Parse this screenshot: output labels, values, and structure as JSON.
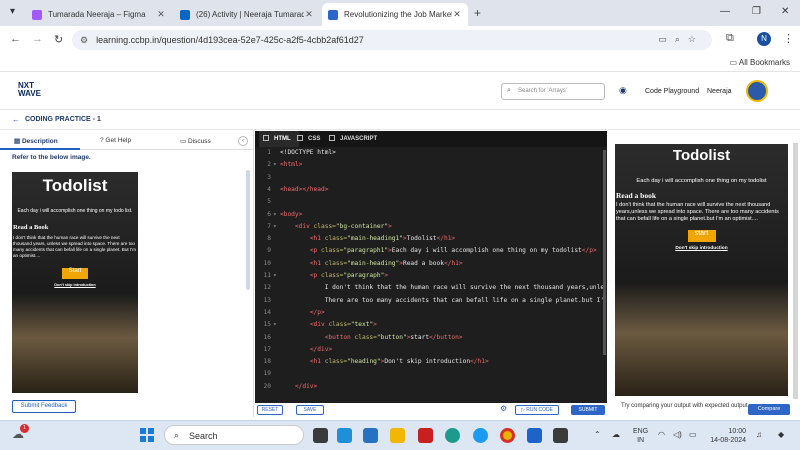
{
  "browser": {
    "tabs": [
      {
        "title": "Tumarada Neeraja – Figma",
        "color": "#a259ff"
      },
      {
        "title": "(26) Activity | Neeraja Tumarad",
        "color": "#0a66c2"
      },
      {
        "title": "Revolutionizing the Job Market",
        "color": "#2d66c7"
      }
    ],
    "new_tab": "+",
    "url": "learning.ccbp.in/question/4d193cea-52e7-425c-a2f5-4cbb2af61d27",
    "profile_initial": "N",
    "bookmarks_label": "All Bookmarks"
  },
  "header": {
    "logo_line1": "NXT",
    "logo_line2": "WAVE",
    "search_placeholder": "Search for 'Arrays'",
    "code_playground": "Code Playground",
    "user_name": "Neeraja"
  },
  "breadcrumb": {
    "label": "CODING PRACTICE - 1"
  },
  "left_tabs": {
    "description": "Description",
    "get_help": "Get Help",
    "discuss": "Discuss"
  },
  "left": {
    "refer": "Refer to the below image.",
    "submit_feedback": "Submit Feedback"
  },
  "preview": {
    "title": "Todolist",
    "subtitle": "Each day i will accomplish one thing on my todo list.",
    "subtitle_right": "Each day i will accomplish one thing on my todolist",
    "heading": "Read a Book",
    "heading_right": "Read a book",
    "paragraph_left": "I don't think that the human race will survive the next thousand years, unless we spread into space. There are too many accidents that can befall life on a single planet. But I'm an optimist....",
    "paragraph_right": "I don't think that the human race will survive the next thousand years,unless we spread into space. There are too many accidents that can befall life on a single planet.but I'm an optimist....",
    "button": "Start",
    "button_right": "start",
    "link": "Don't skip introduction"
  },
  "editor": {
    "tabs": [
      "HTML",
      "CSS",
      "JAVASCRIPT"
    ],
    "lines": [
      {
        "n": "1",
        "f": "",
        "html": "&lt;!DOCTYPE html&gt;"
      },
      {
        "n": "2",
        "f": "▾",
        "html": "<span class='tg'>&lt;html&gt;</span>"
      },
      {
        "n": "3",
        "f": "",
        "html": ""
      },
      {
        "n": "4",
        "f": "",
        "html": "<span class='tg'>&lt;head&gt;&lt;/head&gt;</span>"
      },
      {
        "n": "5",
        "f": "",
        "html": ""
      },
      {
        "n": "6",
        "f": "▾",
        "html": "<span class='tg'>&lt;body&gt;</span>"
      },
      {
        "n": "7",
        "f": "▾",
        "html": "    <span class='tg'>&lt;div</span> <span class='at'>class=</span><span class='st'>\"bg-container\"</span><span class='tg'>&gt;</span>"
      },
      {
        "n": "8",
        "f": "",
        "html": "        <span class='tg'>&lt;h1</span> <span class='at'>class=</span><span class='st'>\"main-heading1\"</span><span class='tg'>&gt;</span>Todolist<span class='tg'>&lt;/h1&gt;</span>"
      },
      {
        "n": "9",
        "f": "",
        "html": "        <span class='tg'>&lt;p</span> <span class='at'>class=</span><span class='st'>\"paragraph1\"</span><span class='tg'>&gt;</span>Each day i will accomplish one thing on my todolist<span class='tg'>&lt;/p&gt;</span>"
      },
      {
        "n": "10",
        "f": "",
        "html": "        <span class='tg'>&lt;h1</span> <span class='at'>class=</span><span class='st'>\"main-heading\"</span><span class='tg'>&gt;</span>Read a book<span class='tg'>&lt;/h1&gt;</span>"
      },
      {
        "n": "11",
        "f": "▾",
        "html": "        <span class='tg'>&lt;p</span> <span class='at'>class=</span><span class='st'>\"paragraph\"</span><span class='tg'>&gt;</span>"
      },
      {
        "n": "12",
        "f": "",
        "html": "            I don't think that the human race will survive the next thousand years,unle"
      },
      {
        "n": "13",
        "f": "",
        "html": "            There are too many accidents that can befall life on a single planet.but I'"
      },
      {
        "n": "14",
        "f": "",
        "html": "        <span class='tg'>&lt;/p&gt;</span>"
      },
      {
        "n": "15",
        "f": "▾",
        "html": "        <span class='tg'>&lt;div</span> <span class='at'>class=</span><span class='st'>\"text\"</span><span class='tg'>&gt;</span>"
      },
      {
        "n": "16",
        "f": "",
        "html": "            <span class='tg'>&lt;button</span> <span class='at'>class=</span><span class='st'>\"button\"</span><span class='tg'>&gt;</span>start<span class='tg'>&lt;/button&gt;</span>"
      },
      {
        "n": "17",
        "f": "",
        "html": "        <span class='tg'>&lt;/div&gt;</span>"
      },
      {
        "n": "18",
        "f": "",
        "html": "        <span class='tg'>&lt;h1</span> <span class='at'>class=</span><span class='st'>\"heading\"</span><span class='tg'>&gt;</span>Don't skip introduction<span class='tg'>&lt;/h1&gt;</span>"
      },
      {
        "n": "19",
        "f": "",
        "html": ""
      },
      {
        "n": "20",
        "f": "",
        "html": "    <span class='tg'>&lt;/div&gt;</span>"
      }
    ],
    "reset": "RESET",
    "save": "SAVE",
    "run_code": "RUN CODE",
    "submit": "SUBMIT"
  },
  "right": {
    "try_text": "Try comparing your output with expected output",
    "compare": "Compare"
  },
  "taskbar": {
    "search": "Search",
    "notif_count": "1",
    "lang1": "ENG",
    "lang2": "IN",
    "time": "10:00",
    "date": "14-08-2024"
  }
}
